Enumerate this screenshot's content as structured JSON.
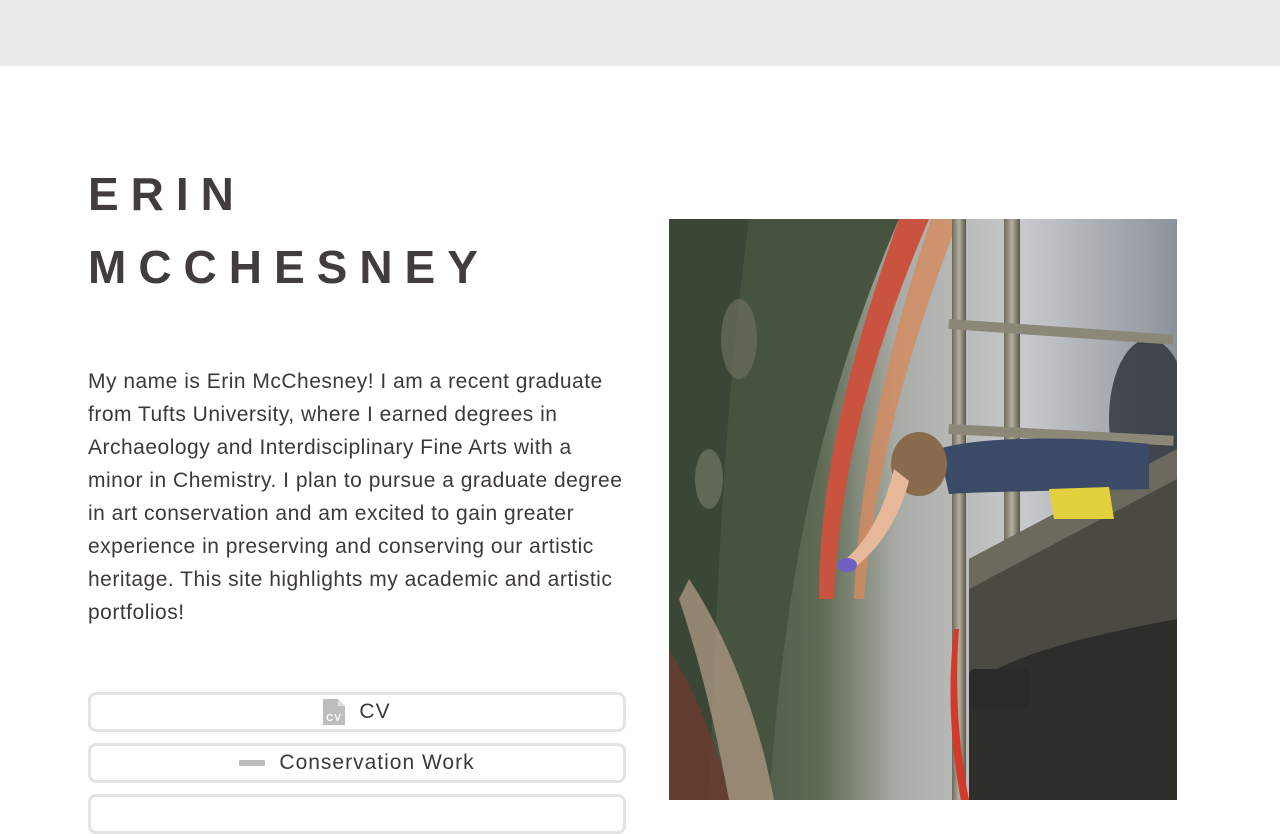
{
  "header": {
    "background": "#ececec"
  },
  "hero": {
    "name_line1": "ERIN",
    "name_line2": "MCCHESNEY",
    "bio": "My name is Erin McChesney! I am a recent graduate from Tufts University, where I earned degrees in Archaeology and Interdisciplinary Fine Arts with a minor in Chemistry. I plan to pursue a graduate degree in art conservation and am excited to gain greater experience in preserving and conserving our artistic heritage. This site highlights my academic and artistic portfolios!"
  },
  "links": [
    {
      "label": "CV",
      "icon": "document-cv-icon"
    },
    {
      "label": "Conservation Work",
      "icon": "dash-icon"
    },
    {
      "label": ""
    }
  ],
  "photo": {
    "subject": "conservator-on-scaffolding-photo"
  },
  "colors": {
    "text": "#413d3d",
    "button_border": "#e3e3e3"
  }
}
